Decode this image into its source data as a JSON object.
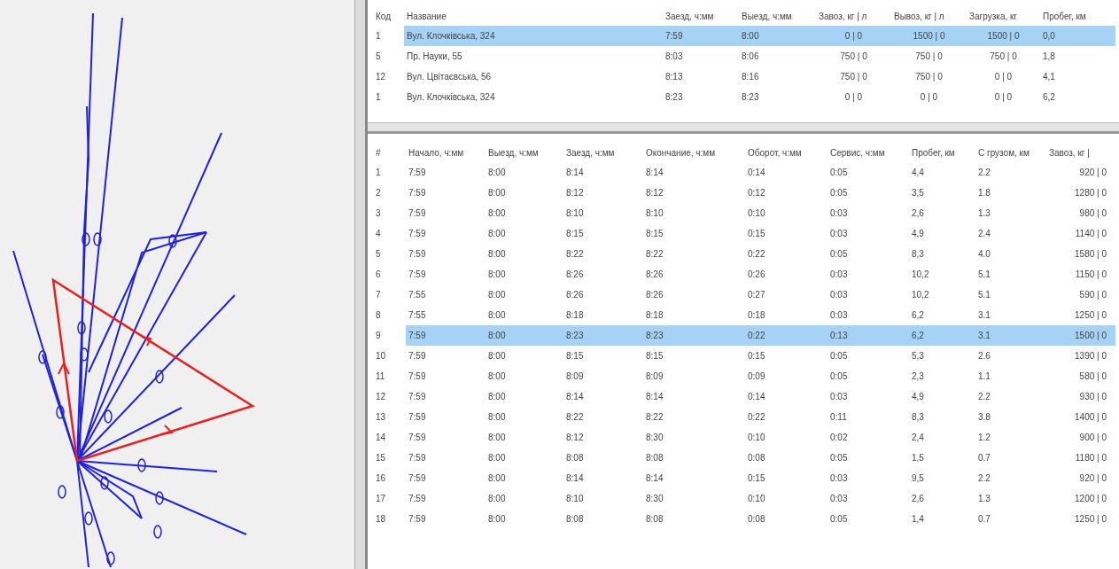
{
  "stops_table": {
    "columns": [
      "Код",
      "Название",
      "Заезд, ч:мм",
      "Выезд, ч:мм",
      "Завоз, кг | л",
      "Вывоз, кг | л",
      "Загрузка, кг",
      "Пробег, км"
    ],
    "rows": [
      {
        "selected": true,
        "cells": [
          "1",
          "Вул. Клочківська, 324",
          "7:59",
          "8:00",
          "0 | 0",
          "1500 | 0",
          "1500 | 0",
          "0,0"
        ]
      },
      {
        "selected": false,
        "cells": [
          "5",
          "Пр. Науки, 55",
          "8:03",
          "8:06",
          "750 | 0",
          "750 | 0",
          "750 | 0",
          "1,8"
        ]
      },
      {
        "selected": false,
        "cells": [
          "12",
          "Вул. Цвітаєвська, 56",
          "8:13",
          "8:16",
          "750 | 0",
          "750 | 0",
          "0 | 0",
          "4,1"
        ]
      },
      {
        "selected": false,
        "cells": [
          "1",
          "Вул. Клочківська, 324",
          "8:23",
          "8:23",
          "0 | 0",
          "0 | 0",
          "0 | 0",
          "6,2"
        ]
      }
    ]
  },
  "trips_table": {
    "columns": [
      "#",
      "Начало, ч:мм",
      "Выезд, ч:мм",
      "Заезд, ч:мм",
      "Окончание, ч:мм",
      "Оборот, ч:мм",
      "Сервис, ч:мм",
      "Пробег, км",
      "С грузом, км",
      "Завоз, кг |"
    ],
    "rows": [
      {
        "selected": false,
        "cells": [
          "1",
          "7:59",
          "8:00",
          "8:14",
          "8:14",
          "0:14",
          "0:05",
          "4,4",
          "2.2",
          "920 | 0"
        ]
      },
      {
        "selected": false,
        "cells": [
          "2",
          "7:59",
          "8:00",
          "8:12",
          "8:12",
          "0:12",
          "0:05",
          "3,5",
          "1.8",
          "1280 | 0"
        ]
      },
      {
        "selected": false,
        "cells": [
          "3",
          "7:59",
          "8:00",
          "8:10",
          "8:10",
          "0:10",
          "0:03",
          "2,6",
          "1.3",
          "980 | 0"
        ]
      },
      {
        "selected": false,
        "cells": [
          "4",
          "7:59",
          "8:00",
          "8:15",
          "8:15",
          "0:15",
          "0:03",
          "4,9",
          "2.4",
          "1140 | 0"
        ]
      },
      {
        "selected": false,
        "cells": [
          "5",
          "7:59",
          "8:00",
          "8:22",
          "8:22",
          "0:22",
          "0:05",
          "8,3",
          "4.0",
          "1580 | 0"
        ]
      },
      {
        "selected": false,
        "cells": [
          "6",
          "7:59",
          "8:00",
          "8:26",
          "8:26",
          "0:26",
          "0:03",
          "10,2",
          "5.1",
          "1150 | 0"
        ]
      },
      {
        "selected": false,
        "cells": [
          "7",
          "7:55",
          "8:00",
          "8:26",
          "8:26",
          "0:27",
          "0:03",
          "10,2",
          "5.1",
          "590 | 0"
        ]
      },
      {
        "selected": false,
        "cells": [
          "8",
          "7:55",
          "8:00",
          "8:18",
          "8:18",
          "0:18",
          "0:03",
          "6,2",
          "3.1",
          "1250 | 0"
        ]
      },
      {
        "selected": true,
        "cells": [
          "9",
          "7:59",
          "8:00",
          "8:23",
          "8:23",
          "0:22",
          "0:13",
          "6,2",
          "3.1",
          "1500 | 0"
        ]
      },
      {
        "selected": false,
        "cells": [
          "10",
          "7:59",
          "8:00",
          "8:15",
          "8:15",
          "0:15",
          "0:05",
          "5,3",
          "2.6",
          "1390 | 0"
        ]
      },
      {
        "selected": false,
        "cells": [
          "11",
          "7:59",
          "8:00",
          "8:09",
          "8:09",
          "0:09",
          "0:05",
          "2,3",
          "1.1",
          "580 | 0"
        ]
      },
      {
        "selected": false,
        "cells": [
          "12",
          "7:59",
          "8:00",
          "8:14",
          "8:14",
          "0:14",
          "0:03",
          "4,9",
          "2.2",
          "930 | 0"
        ]
      },
      {
        "selected": false,
        "cells": [
          "13",
          "7:59",
          "8:00",
          "8:22",
          "8:22",
          "0:22",
          "0:11",
          "8,3",
          "3.8",
          "1400 | 0"
        ]
      },
      {
        "selected": false,
        "cells": [
          "14",
          "7:59",
          "8:00",
          "8:12",
          "8:30",
          "0:10",
          "0:02",
          "2,4",
          "1.2",
          "900 | 0"
        ]
      },
      {
        "selected": false,
        "cells": [
          "15",
          "7:59",
          "8:00",
          "8:08",
          "8:08",
          "0:08",
          "0:05",
          "1,5",
          "0.7",
          "1180 | 0"
        ]
      },
      {
        "selected": false,
        "cells": [
          "16",
          "7:59",
          "8:00",
          "8:14",
          "8:14",
          "0:15",
          "0:03",
          "9,5",
          "2.2",
          "920 | 0"
        ]
      },
      {
        "selected": false,
        "cells": [
          "17",
          "7:59",
          "8:00",
          "8:10",
          "8:30",
          "0:10",
          "0:03",
          "2,6",
          "1.3",
          "1200 | 0"
        ]
      },
      {
        "selected": false,
        "cells": [
          "18",
          "7:59",
          "8:00",
          "8:08",
          "8:08",
          "0:08",
          "0:05",
          "1,4",
          "0.7",
          "1250 | 0"
        ]
      }
    ]
  }
}
